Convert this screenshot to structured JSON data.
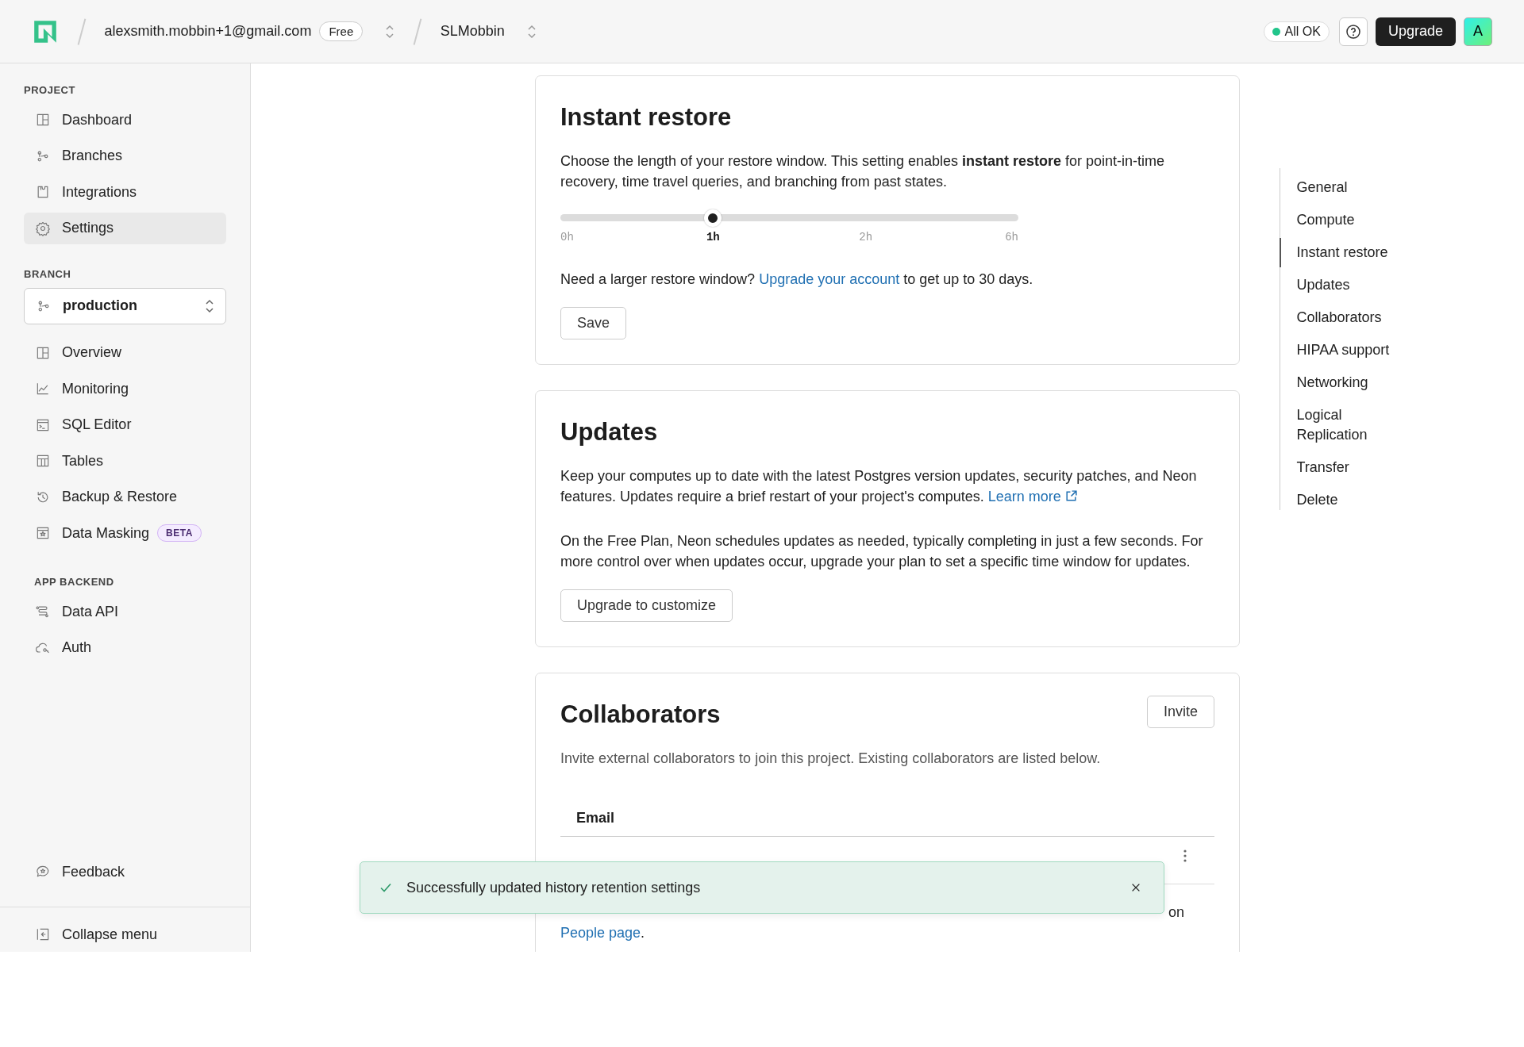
{
  "topbar": {
    "account": "alexsmith.mobbin+1@gmail.com",
    "plan_badge": "Free",
    "project": "SLMobbin",
    "status": {
      "label": "All OK",
      "color": "#22c58b"
    },
    "upgrade_button": "Upgrade",
    "avatar": "A"
  },
  "sidebar": {
    "sections": [
      {
        "heading": "PROJECT",
        "items": [
          {
            "label": "Dashboard",
            "selected": false
          },
          {
            "label": "Branches",
            "selected": false
          },
          {
            "label": "Integrations",
            "selected": false
          },
          {
            "label": "Settings",
            "selected": true
          }
        ]
      },
      {
        "heading": "BRANCH",
        "selector": {
          "value": "production"
        },
        "items": [
          {
            "label": "Overview",
            "selected": false
          },
          {
            "label": "Monitoring",
            "selected": false
          },
          {
            "label": "SQL Editor",
            "selected": false
          },
          {
            "label": "Tables",
            "selected": false
          },
          {
            "label": "Backup & Restore",
            "selected": false
          },
          {
            "label": "Data Masking",
            "badge": "BETA",
            "selected": false
          }
        ]
      },
      {
        "heading": "APP BACKEND",
        "items": [
          {
            "label": "Data API",
            "selected": false
          },
          {
            "label": "Auth",
            "selected": false
          }
        ]
      }
    ],
    "footer_items": [
      {
        "label": "Feedback"
      },
      {
        "label": "Collapse menu"
      }
    ]
  },
  "instant_restore": {
    "title": "Instant restore",
    "description": "Choose the length of your restore window. This setting enables **instant restore** for point-in-time recovery, time travel queries, and branching from past states.",
    "slider": {
      "level": 0.333,
      "ticks": [
        {
          "label": "0h",
          "selected": false
        },
        {
          "label": "1h",
          "selected": true
        },
        {
          "label": "2h",
          "selected": false
        },
        {
          "label": "6h",
          "selected": false
        }
      ]
    },
    "upsell": {
      "before": "Need a larger restore window?",
      "link": "Upgrade your account",
      "after": "to get up to 30 days."
    },
    "save_button": "Save"
  },
  "updates": {
    "title": "Updates",
    "paragraph_1": "Keep your computes up to date with the latest Postgres version updates, security patches, and Neon features. Updates require a brief restart of your project's computes.",
    "learn_more": "Learn more",
    "paragraph_2": "On the Free Plan, Neon schedules updates as needed, typically completing in just a few seconds. For more control over when updates occur, upgrade your plan to set a specific time window for updates.",
    "button": "Upgrade to customize"
  },
  "collaborators": {
    "title": "Collaborators",
    "invite_button": "Invite",
    "description": "Invite external collaborators to join this project. Existing collaborators are listed below.",
    "columns": [
      "Email"
    ],
    "owner_note": {
      "tail": "on",
      "link": "People page",
      "end": "."
    }
  },
  "toast": {
    "message": "Successfully updated history retention settings"
  },
  "section_nav": [
    {
      "label": "General",
      "selected": false
    },
    {
      "label": "Compute",
      "selected": false
    },
    {
      "label": "Instant restore",
      "selected": true
    },
    {
      "label": "Updates",
      "selected": false
    },
    {
      "label": "Collaborators",
      "selected": false
    },
    {
      "label": "HIPAA support",
      "selected": false
    },
    {
      "label": "Networking",
      "selected": false
    },
    {
      "label": "Logical Replication",
      "selected": false
    },
    {
      "label": "Transfer",
      "selected": false
    },
    {
      "label": "Delete",
      "selected": false
    }
  ]
}
